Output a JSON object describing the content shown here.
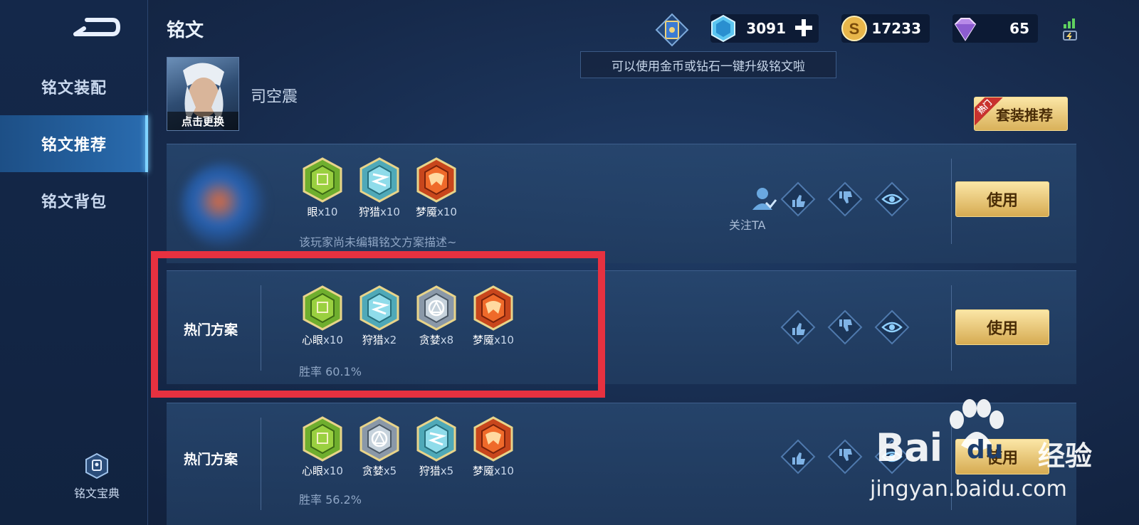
{
  "header": {
    "title": "铭文",
    "resources": [
      {
        "icon": "crystal-icon",
        "value": "3091"
      },
      {
        "icon": "gold-coin-icon",
        "value": "17233"
      },
      {
        "icon": "diamond-icon",
        "value": "65"
      }
    ],
    "tooltip": "可以使用金币或钻石一键升级铭文啦"
  },
  "sidebar": {
    "items": [
      {
        "label": "铭文装配"
      },
      {
        "label": "铭文推荐"
      },
      {
        "label": "铭文背包"
      }
    ],
    "active_index": 1,
    "codex_label": "铭文宝典"
  },
  "hero": {
    "name": "司空震",
    "portrait_caption": "点击更换"
  },
  "set_recommend": {
    "label": "套装推荐",
    "badge": "热门"
  },
  "plans": [
    {
      "label": "",
      "runes": [
        {
          "name": "眼",
          "count": "x10",
          "color": "green"
        },
        {
          "name": "狩猎",
          "count": "x10",
          "color": "cyan"
        },
        {
          "name": "梦魇",
          "count": "x10",
          "color": "red"
        }
      ],
      "description": "该玩家尚未编辑铭文方案描述~",
      "follow_label": "关注TA",
      "use_label": "使用"
    },
    {
      "label": "热门方案",
      "runes": [
        {
          "name": "心眼",
          "count": "x10",
          "color": "green"
        },
        {
          "name": "狩猎",
          "count": "x2",
          "color": "cyan"
        },
        {
          "name": "贪婪",
          "count": "x8",
          "color": "silver"
        },
        {
          "name": "梦魇",
          "count": "x10",
          "color": "red"
        }
      ],
      "win_rate": "胜率 60.1%",
      "use_label": "使用"
    },
    {
      "label": "热门方案",
      "runes": [
        {
          "name": "心眼",
          "count": "x10",
          "color": "green"
        },
        {
          "name": "贪婪",
          "count": "x5",
          "color": "silver"
        },
        {
          "name": "狩猎",
          "count": "x5",
          "color": "cyan"
        },
        {
          "name": "梦魇",
          "count": "x10",
          "color": "red"
        }
      ],
      "win_rate": "胜率 56.2%",
      "use_label": "使用"
    }
  ],
  "watermark": {
    "brand_latin": "Bai",
    "brand_du": "du",
    "brand_cn": "经验",
    "url": "jingyan.baidu.com"
  },
  "colors": {
    "accent_gold": "#d9b15a",
    "highlight_red": "#e63140",
    "active_tab": "#24609e"
  }
}
